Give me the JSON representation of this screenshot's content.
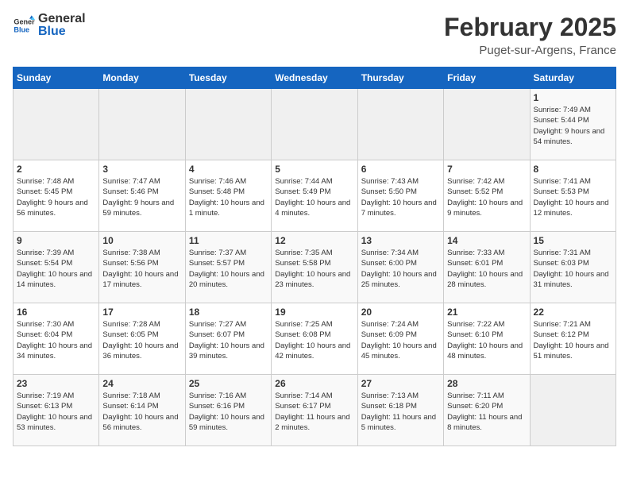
{
  "header": {
    "logo_general": "General",
    "logo_blue": "Blue",
    "title": "February 2025",
    "subtitle": "Puget-sur-Argens, France"
  },
  "days_of_week": [
    "Sunday",
    "Monday",
    "Tuesday",
    "Wednesday",
    "Thursday",
    "Friday",
    "Saturday"
  ],
  "weeks": [
    [
      {
        "day": "",
        "info": ""
      },
      {
        "day": "",
        "info": ""
      },
      {
        "day": "",
        "info": ""
      },
      {
        "day": "",
        "info": ""
      },
      {
        "day": "",
        "info": ""
      },
      {
        "day": "",
        "info": ""
      },
      {
        "day": "1",
        "info": "Sunrise: 7:49 AM\nSunset: 5:44 PM\nDaylight: 9 hours and 54 minutes."
      }
    ],
    [
      {
        "day": "2",
        "info": "Sunrise: 7:48 AM\nSunset: 5:45 PM\nDaylight: 9 hours and 56 minutes."
      },
      {
        "day": "3",
        "info": "Sunrise: 7:47 AM\nSunset: 5:46 PM\nDaylight: 9 hours and 59 minutes."
      },
      {
        "day": "4",
        "info": "Sunrise: 7:46 AM\nSunset: 5:48 PM\nDaylight: 10 hours and 1 minute."
      },
      {
        "day": "5",
        "info": "Sunrise: 7:44 AM\nSunset: 5:49 PM\nDaylight: 10 hours and 4 minutes."
      },
      {
        "day": "6",
        "info": "Sunrise: 7:43 AM\nSunset: 5:50 PM\nDaylight: 10 hours and 7 minutes."
      },
      {
        "day": "7",
        "info": "Sunrise: 7:42 AM\nSunset: 5:52 PM\nDaylight: 10 hours and 9 minutes."
      },
      {
        "day": "8",
        "info": "Sunrise: 7:41 AM\nSunset: 5:53 PM\nDaylight: 10 hours and 12 minutes."
      }
    ],
    [
      {
        "day": "9",
        "info": "Sunrise: 7:39 AM\nSunset: 5:54 PM\nDaylight: 10 hours and 14 minutes."
      },
      {
        "day": "10",
        "info": "Sunrise: 7:38 AM\nSunset: 5:56 PM\nDaylight: 10 hours and 17 minutes."
      },
      {
        "day": "11",
        "info": "Sunrise: 7:37 AM\nSunset: 5:57 PM\nDaylight: 10 hours and 20 minutes."
      },
      {
        "day": "12",
        "info": "Sunrise: 7:35 AM\nSunset: 5:58 PM\nDaylight: 10 hours and 23 minutes."
      },
      {
        "day": "13",
        "info": "Sunrise: 7:34 AM\nSunset: 6:00 PM\nDaylight: 10 hours and 25 minutes."
      },
      {
        "day": "14",
        "info": "Sunrise: 7:33 AM\nSunset: 6:01 PM\nDaylight: 10 hours and 28 minutes."
      },
      {
        "day": "15",
        "info": "Sunrise: 7:31 AM\nSunset: 6:03 PM\nDaylight: 10 hours and 31 minutes."
      }
    ],
    [
      {
        "day": "16",
        "info": "Sunrise: 7:30 AM\nSunset: 6:04 PM\nDaylight: 10 hours and 34 minutes."
      },
      {
        "day": "17",
        "info": "Sunrise: 7:28 AM\nSunset: 6:05 PM\nDaylight: 10 hours and 36 minutes."
      },
      {
        "day": "18",
        "info": "Sunrise: 7:27 AM\nSunset: 6:07 PM\nDaylight: 10 hours and 39 minutes."
      },
      {
        "day": "19",
        "info": "Sunrise: 7:25 AM\nSunset: 6:08 PM\nDaylight: 10 hours and 42 minutes."
      },
      {
        "day": "20",
        "info": "Sunrise: 7:24 AM\nSunset: 6:09 PM\nDaylight: 10 hours and 45 minutes."
      },
      {
        "day": "21",
        "info": "Sunrise: 7:22 AM\nSunset: 6:10 PM\nDaylight: 10 hours and 48 minutes."
      },
      {
        "day": "22",
        "info": "Sunrise: 7:21 AM\nSunset: 6:12 PM\nDaylight: 10 hours and 51 minutes."
      }
    ],
    [
      {
        "day": "23",
        "info": "Sunrise: 7:19 AM\nSunset: 6:13 PM\nDaylight: 10 hours and 53 minutes."
      },
      {
        "day": "24",
        "info": "Sunrise: 7:18 AM\nSunset: 6:14 PM\nDaylight: 10 hours and 56 minutes."
      },
      {
        "day": "25",
        "info": "Sunrise: 7:16 AM\nSunset: 6:16 PM\nDaylight: 10 hours and 59 minutes."
      },
      {
        "day": "26",
        "info": "Sunrise: 7:14 AM\nSunset: 6:17 PM\nDaylight: 11 hours and 2 minutes."
      },
      {
        "day": "27",
        "info": "Sunrise: 7:13 AM\nSunset: 6:18 PM\nDaylight: 11 hours and 5 minutes."
      },
      {
        "day": "28",
        "info": "Sunrise: 7:11 AM\nSunset: 6:20 PM\nDaylight: 11 hours and 8 minutes."
      },
      {
        "day": "",
        "info": ""
      }
    ]
  ]
}
